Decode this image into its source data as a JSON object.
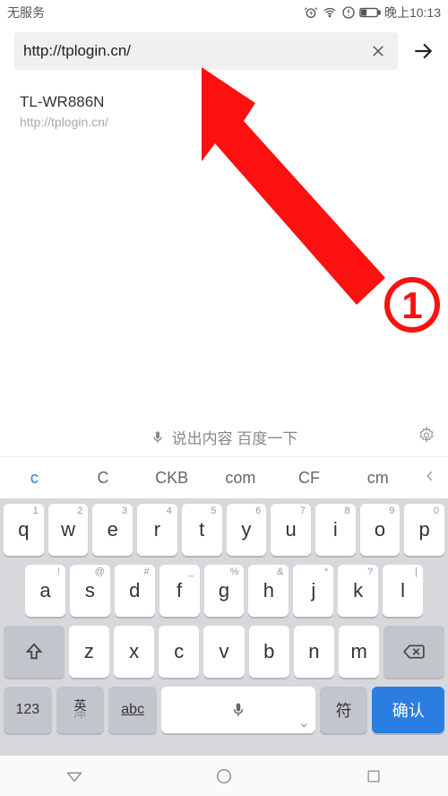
{
  "status": {
    "carrier": "无服务",
    "time": "晚上10:13"
  },
  "address": {
    "url": "http://tplogin.cn/"
  },
  "suggestion": {
    "title": "TL-WR886N",
    "url": "http://tplogin.cn/"
  },
  "annotation": {
    "label": "1"
  },
  "voice_hint": "说出内容 百度一下",
  "sug_strip": [
    "c",
    "C",
    "CKB",
    "com",
    "CF",
    "cm"
  ],
  "keyboard": {
    "row1": [
      {
        "m": "q",
        "a": "1"
      },
      {
        "m": "w",
        "a": "2"
      },
      {
        "m": "e",
        "a": "3"
      },
      {
        "m": "r",
        "a": "4"
      },
      {
        "m": "t",
        "a": "5"
      },
      {
        "m": "y",
        "a": "6"
      },
      {
        "m": "u",
        "a": "7"
      },
      {
        "m": "i",
        "a": "8"
      },
      {
        "m": "o",
        "a": "9"
      },
      {
        "m": "p",
        "a": "0"
      }
    ],
    "row2": [
      {
        "m": "a",
        "a": "!"
      },
      {
        "m": "s",
        "a": "@"
      },
      {
        "m": "d",
        "a": "#"
      },
      {
        "m": "f",
        "a": "_"
      },
      {
        "m": "g",
        "a": "%"
      },
      {
        "m": "h",
        "a": "&"
      },
      {
        "m": "j",
        "a": "*"
      },
      {
        "m": "k",
        "a": "?"
      },
      {
        "m": "l",
        "a": "|"
      }
    ],
    "row3": [
      {
        "m": "z",
        "a": ""
      },
      {
        "m": "x",
        "a": ""
      },
      {
        "m": "c",
        "a": ""
      },
      {
        "m": "v",
        "a": ""
      },
      {
        "m": "b",
        "a": ""
      },
      {
        "m": "n",
        "a": ""
      },
      {
        "m": "m",
        "a": ""
      }
    ],
    "row4": {
      "numkey": "123",
      "lang_top": "英",
      "lang_bot": "/中",
      "abc": "abc",
      "sym": "符",
      "confirm": "确认"
    }
  }
}
